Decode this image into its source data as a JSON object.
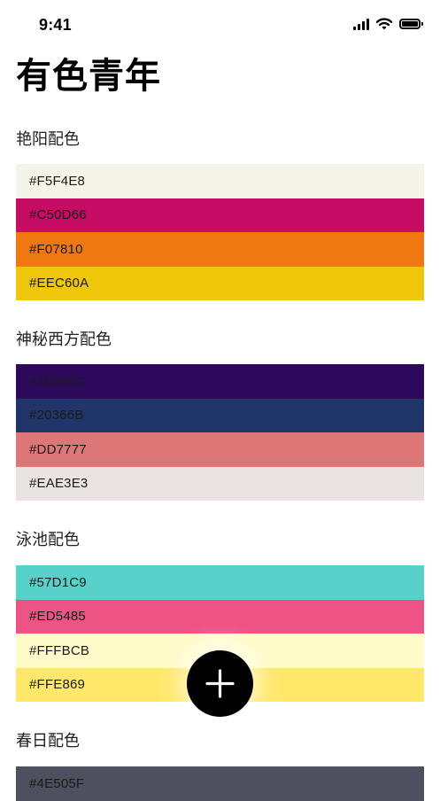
{
  "status_bar": {
    "time": "9:41"
  },
  "page": {
    "title": "有色青年"
  },
  "palettes": [
    {
      "name": "艳阳配色",
      "swatches": [
        {
          "hex": "#F5F4E8",
          "color": "#F5F4E8"
        },
        {
          "hex": "#C50D66",
          "color": "#C50D66"
        },
        {
          "hex": "#F07810",
          "color": "#F07810"
        },
        {
          "hex": "#EEC60A",
          "color": "#EEC60A"
        }
      ]
    },
    {
      "name": "神秘西方配色",
      "swatches": [
        {
          "hex": "#2D095C",
          "color": "#2D095C"
        },
        {
          "hex": "#20366B",
          "color": "#20366B"
        },
        {
          "hex": "#DD7777",
          "color": "#DD7777"
        },
        {
          "hex": "#EAE3E3",
          "color": "#EAE3E3"
        }
      ]
    },
    {
      "name": "泳池配色",
      "swatches": [
        {
          "hex": "#57D1C9",
          "color": "#57D1C9"
        },
        {
          "hex": "#ED5485",
          "color": "#ED5485"
        },
        {
          "hex": "#FFFBCB",
          "color": "#FFFBCB"
        },
        {
          "hex": "#FFE869",
          "color": "#FFE869"
        }
      ]
    },
    {
      "name": "春日配色",
      "swatches": [
        {
          "hex": "#4E505F",
          "color": "#4E505F"
        }
      ]
    }
  ],
  "fab": {
    "icon": "plus-icon"
  }
}
